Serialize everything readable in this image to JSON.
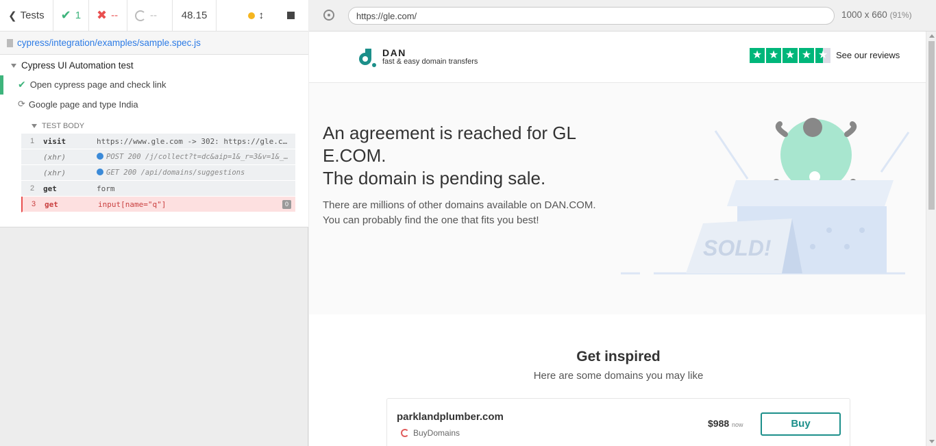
{
  "reporter": {
    "tests_label": "Tests",
    "passed": "1",
    "failed": "--",
    "pending": "--",
    "duration": "48.15",
    "spec_path": "cypress/integration/examples/sample.spec.js",
    "suite_title": "Cypress UI Automation test",
    "tests": [
      {
        "title": "Open cypress page and check link",
        "state": "passed"
      },
      {
        "title": "Google page and type India",
        "state": "running"
      }
    ],
    "test_body_label": "TEST BODY",
    "commands": [
      {
        "num": "1",
        "name": "visit",
        "message": "https://www.gle.com -> 302: https://gle.com/"
      },
      {
        "num": "",
        "name": "(xhr)",
        "message": "POST 200 /j/collect?t=dc&aip=1&_r=3&v=1&_v=j92"
      },
      {
        "num": "",
        "name": "(xhr)",
        "message": "GET 200 /api/domains/suggestions"
      },
      {
        "num": "2",
        "name": "get",
        "message": "form"
      },
      {
        "num": "3",
        "name": "get",
        "message": "input[name=\"q\"]",
        "badge": "0"
      }
    ],
    "status_colors": {
      "pass": "#3eb47c",
      "fail": "#e94f4f",
      "running": "#f5b51f"
    }
  },
  "aut_header": {
    "url": "https://gle.com/",
    "viewport": "1000 x 660",
    "zoom": "(91%)"
  },
  "site": {
    "brand": "DAN",
    "tagline": "fast & easy domain transfers",
    "reviews_link": "See our reviews",
    "rating_stars": 4.5,
    "hero_title_lines": [
      "An agreement is reached for GL",
      "E.COM.",
      "The domain is pending sale."
    ],
    "hero_text": "There are millions of other domains available on DAN.COM. You can probably find the one that fits you best!",
    "sold_text": "SOLD!",
    "inspire_title": "Get inspired",
    "inspire_sub": "Here are some domains you may like",
    "suggestion": {
      "domain": "parklandplumber.com",
      "seller": "BuyDomains",
      "price": "$988",
      "price_note": "now",
      "buy_label": "Buy"
    },
    "brand_color": "#1c8f8a",
    "trustpilot_green": "#00b67a"
  }
}
